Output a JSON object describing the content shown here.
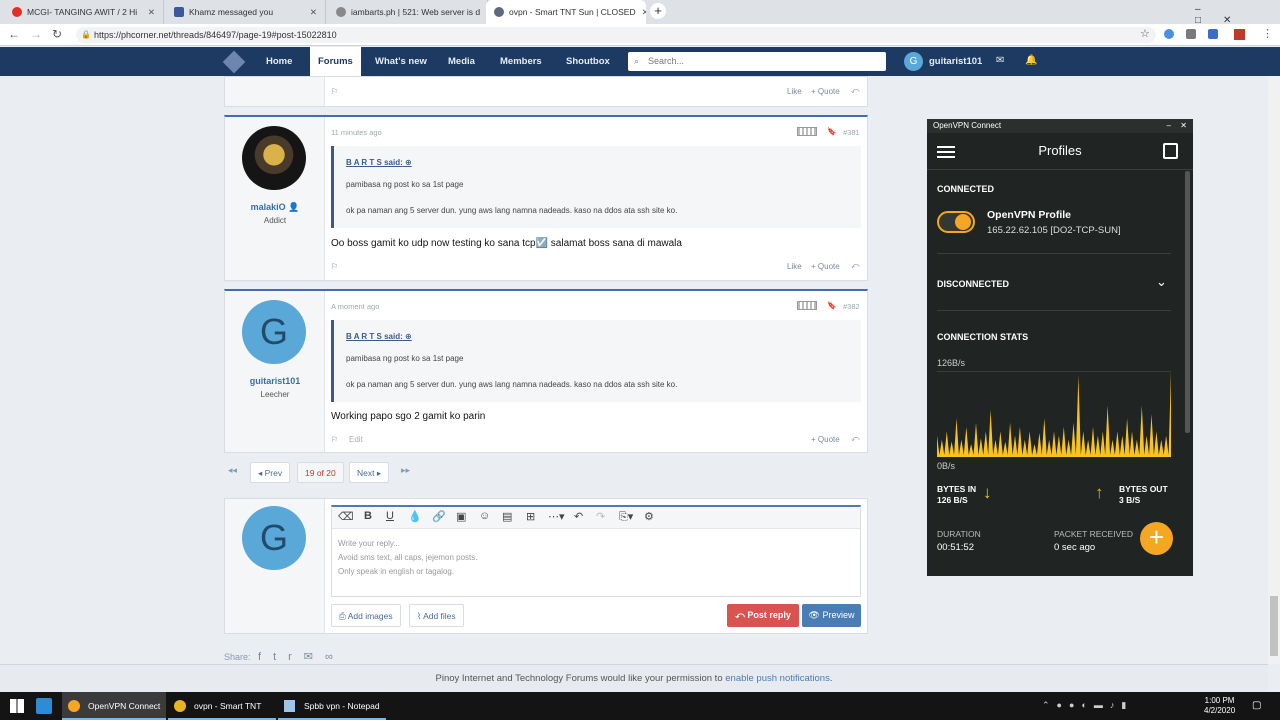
{
  "browser": {
    "tabs": [
      {
        "title": "MCGI- TANGING AWIT / 2 Hi",
        "icon": "youtube-icon",
        "color": "#e52d27"
      },
      {
        "title": "Khamz messaged you",
        "icon": "facebook-icon",
        "color": "#3b5998"
      },
      {
        "title": "iambarts.ph | 521: Web server is d",
        "icon": "globe-icon",
        "color": "#777777"
      },
      {
        "title": "ovpn - Smart TNT Sun | CLOSED",
        "icon": "site-icon",
        "color": "#5b6b80"
      }
    ],
    "url": "https://phcorner.net/threads/846497/page-19#post-15022810"
  },
  "nav": {
    "items": [
      "Home",
      "Forums",
      "What's new",
      "Media",
      "Members",
      "Shoutbox"
    ],
    "search_placeholder": "Search...",
    "avatar_letter": "G",
    "username": "guitarist101"
  },
  "top_post": {
    "like": "Like",
    "quote": "+ Quote"
  },
  "posts": [
    {
      "time": "11 minutes ago",
      "number": "#381",
      "username": "malakiO",
      "role": "Addict",
      "quote_author": "B A R T S said:",
      "quote_lines": [
        "pamibasa ng post ko sa 1st page",
        "ok pa naman ang 5 server dun. yung aws lang namna nadeads. kaso na ddos ata ssh site ko."
      ],
      "body": "Oo boss gamit ko udp now testing ko sana tcp☑️ salamat boss sana di mawala",
      "like": "Like",
      "quote": "+ Quote"
    },
    {
      "time": "A moment ago",
      "number": "#382",
      "avatar_letter": "G",
      "username": "guitarist101",
      "role": "Leecher",
      "quote_author": "B A R T S said:",
      "quote_lines": [
        "pamibasa ng post ko sa 1st page",
        "ok pa naman ang 5 server dun. yung aws lang namna nadeads. kaso na ddos ata ssh site ko."
      ],
      "body": "Working papo sgo 2 gamit ko parin",
      "edit": "Edit",
      "quote": "+ Quote"
    }
  ],
  "pagination": {
    "prev": "◂ Prev",
    "current": "19 of 20",
    "next": "Next ▸"
  },
  "reply": {
    "avatar_letter": "G",
    "placeholder_lines": [
      "Write your reply...",
      "Avoid sms text, all caps, jejemon posts.",
      "Only speak in english or tagalog."
    ],
    "add_images": "Add images",
    "add_files": "Add files",
    "post_reply": "Post reply",
    "preview": "Preview"
  },
  "share_label": "Share:",
  "notification": {
    "text": "Pinoy Internet and Technology Forums would like your permission to ",
    "link": "enable push notifications",
    "end": "."
  },
  "openvpn": {
    "window_title": "OpenVPN Connect",
    "header": "Profiles",
    "connected_label": "CONNECTED",
    "profile_name": "OpenVPN Profile",
    "profile_detail": "165.22.62.105 [DO2-TCP-SUN]",
    "disconnected_label": "DISCONNECTED",
    "stats_label": "CONNECTION STATS",
    "max_rate": "126B/s",
    "min_rate": "0B/s",
    "bytes_in_label": "BYTES IN",
    "bytes_in": "126 B/S",
    "bytes_out_label": "BYTES OUT",
    "bytes_out": "3 B/S",
    "duration_label": "DURATION",
    "duration": "00:51:52",
    "packet_label": "PACKET RECEIVED",
    "packet": "0 sec ago",
    "traffic": [
      0.25,
      0.2,
      0.3,
      0.18,
      0.45,
      0.2,
      0.35,
      0.15,
      0.4,
      0.22,
      0.3,
      0.55,
      0.2,
      0.3,
      0.18,
      0.4,
      0.25,
      0.35,
      0.2,
      0.3,
      0.15,
      0.28,
      0.45,
      0.2,
      0.3,
      0.25,
      0.35,
      0.2,
      0.4,
      0.95,
      0.3,
      0.2,
      0.35,
      0.25,
      0.3,
      0.6,
      0.2,
      0.3,
      0.25,
      0.45,
      0.3,
      0.2,
      0.6,
      0.25,
      0.5,
      0.3,
      0.2,
      0.25,
      1.0
    ],
    "accent": "#f5a623",
    "graph_color": "#f8c322"
  },
  "taskbar": {
    "apps": [
      "OpenVPN Connect",
      "ovpn - Smart TNT Su...",
      "Spbb vpn - Notepad"
    ],
    "time": "1:00 PM",
    "date": "4/2/2020"
  }
}
